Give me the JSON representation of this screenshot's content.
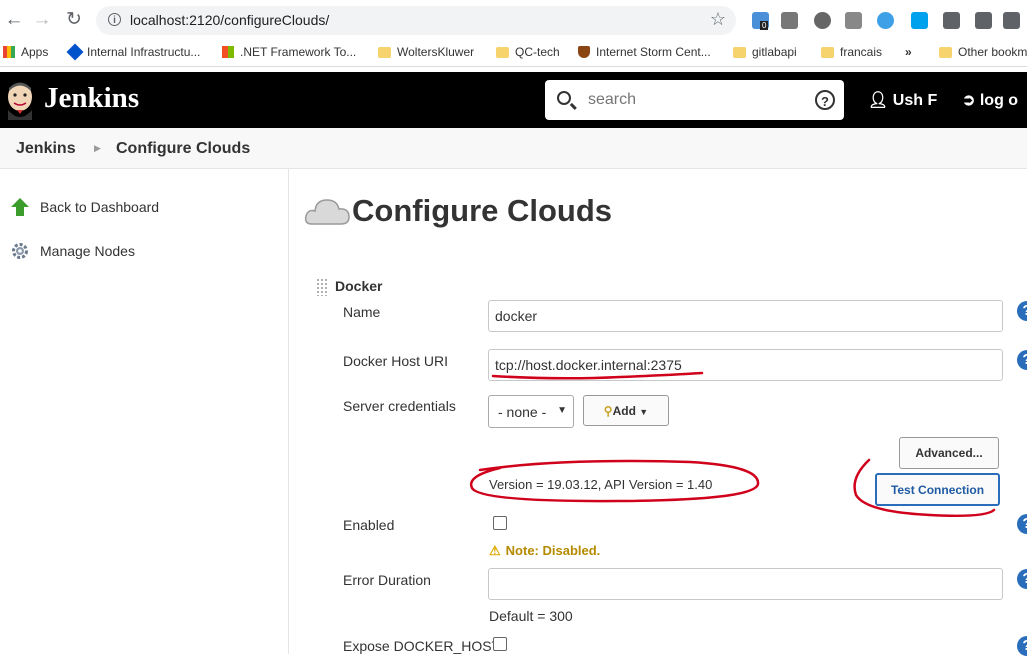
{
  "browser": {
    "url": "localhost:2120/configureClouds/",
    "ext_badge": "0",
    "bookmarks": [
      "Apps",
      "Internal Infrastructu...",
      ".NET Framework To...",
      "WoltersKluwer",
      "QC-tech",
      "Internet Storm Cent...",
      "gitlabapi",
      "francais",
      "»",
      "Other bookm"
    ]
  },
  "header": {
    "title": "Jenkins",
    "search_placeholder": "search",
    "user": "Ush F",
    "logout": "log o"
  },
  "breadcrumb": [
    "Jenkins",
    "Configure Clouds"
  ],
  "sidebar": {
    "items": [
      {
        "label": "Back to Dashboard",
        "icon": "arrow-up-icon"
      },
      {
        "label": "Manage Nodes",
        "icon": "gear-icon"
      }
    ]
  },
  "main": {
    "title": "Configure Clouds",
    "section": "Docker",
    "fields": {
      "name_label": "Name",
      "name_value": "docker",
      "host_label": "Docker Host URI",
      "host_value": "tcp://host.docker.internal:2375",
      "cred_label": "Server credentials",
      "cred_value": "- none -",
      "add_label": "Add",
      "advanced_label": "Advanced...",
      "test_label": "Test Connection",
      "version_status": "Version = 19.03.12, API Version = 1.40",
      "enabled_label": "Enabled",
      "enabled_checked": false,
      "warning": "Note: Disabled.",
      "error_label": "Error Duration",
      "error_value": "",
      "error_default": "Default = 300",
      "expose_label": "Expose DOCKER_HOST",
      "expose_checked": false
    },
    "help_glyph": "?"
  },
  "colors": {
    "header_bg": "#000000",
    "accent": "#2a6ebb",
    "annotation_red": "#d0021b",
    "warning": "#b58a00"
  }
}
